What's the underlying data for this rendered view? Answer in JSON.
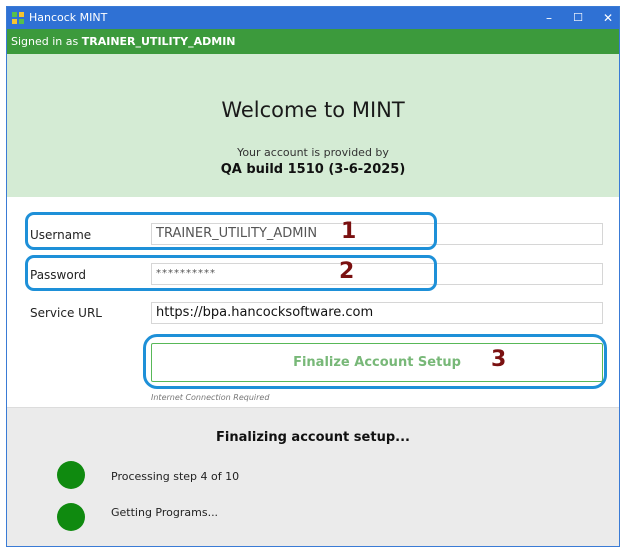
{
  "window": {
    "title": "Hancock MINT",
    "minimize_glyph": "–",
    "maximize_glyph": "☐",
    "close_glyph": "✕"
  },
  "signin": {
    "prefix": "Signed in as ",
    "user": "TRAINER_UTILITY_ADMIN"
  },
  "welcome": {
    "title": "Welcome to MINT",
    "provided_by": "Your account is provided by",
    "build": "QA build 1510 (3-6-2025)"
  },
  "form": {
    "username_label": "Username",
    "username_value": "TRAINER_UTILITY_ADMIN",
    "password_label": "Password",
    "password_value": "**********",
    "service_url_label": "Service URL",
    "service_url_value": "https://bpa.hancocksoftware.com",
    "finalize_button": "Finalize Account Setup",
    "connection_note": "Internet Connection Required"
  },
  "annotations": {
    "n1": "1",
    "n2": "2",
    "n3": "3",
    "callout_color": "#1e90d8",
    "number_color": "#7a1010"
  },
  "status": {
    "title": "Finalizing account setup...",
    "steps": [
      {
        "text": "Processing step 4 of 10"
      },
      {
        "text": "Getting Programs..."
      }
    ],
    "dot_color": "#0f8a0f"
  },
  "colors": {
    "titlebar": "#2f71d4",
    "signin_bar": "#3c9a3c",
    "welcome_bg": "#d4ebd4"
  }
}
